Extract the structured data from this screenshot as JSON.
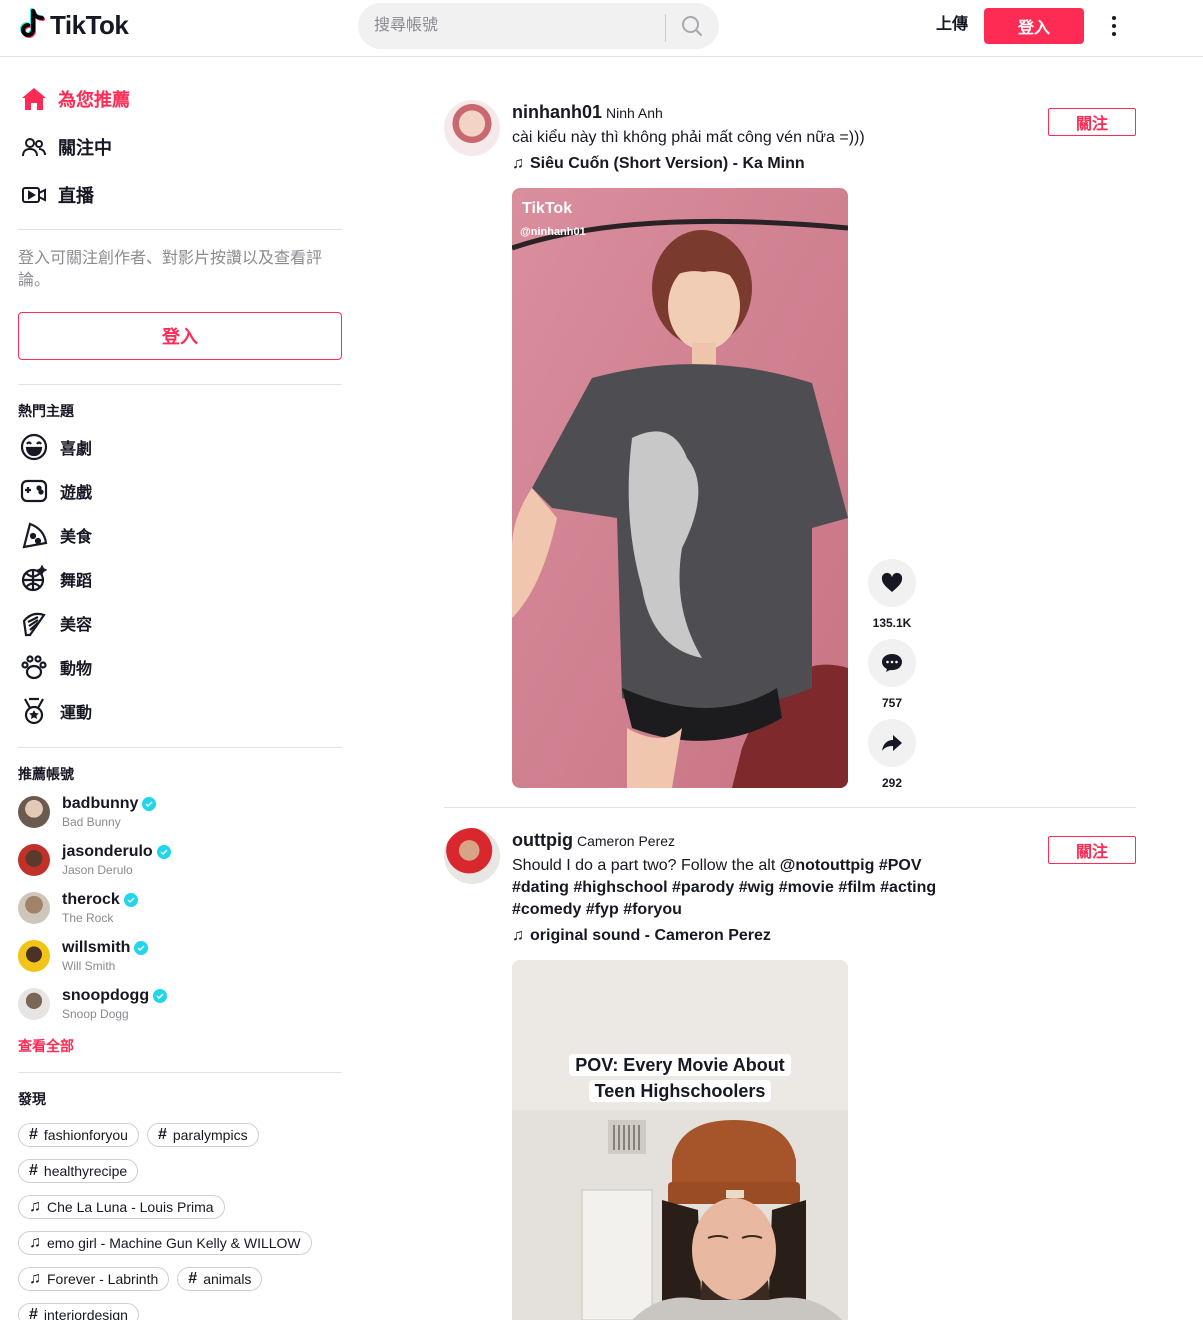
{
  "header": {
    "logo_text": "TikTok",
    "search_placeholder": "搜尋帳號",
    "upload_label": "上傳",
    "login_label": "登入"
  },
  "sidebar": {
    "nav": [
      {
        "label": "為您推薦",
        "icon": "home-icon",
        "active": true
      },
      {
        "label": "關注中",
        "icon": "users-icon"
      },
      {
        "label": "直播",
        "icon": "live-icon"
      }
    ],
    "login_note": "登入可關注創作者、對影片按讚以及查看評論。",
    "login_button": "登入",
    "topics_title": "熱門主題",
    "topics": [
      {
        "label": "喜劇",
        "icon": "comedy-icon"
      },
      {
        "label": "遊戲",
        "icon": "gaming-icon"
      },
      {
        "label": "美食",
        "icon": "food-icon"
      },
      {
        "label": "舞蹈",
        "icon": "dance-icon"
      },
      {
        "label": "美容",
        "icon": "beauty-icon"
      },
      {
        "label": "動物",
        "icon": "animals-icon"
      },
      {
        "label": "運動",
        "icon": "sports-icon"
      }
    ],
    "accounts_title": "推薦帳號",
    "accounts": [
      {
        "handle": "badbunny",
        "name": "Bad Bunny",
        "color": "#6b5a4e"
      },
      {
        "handle": "jasonderulo",
        "name": "Jason Derulo",
        "color": "#c2302a"
      },
      {
        "handle": "therock",
        "name": "The Rock",
        "color": "#8a7a68"
      },
      {
        "handle": "willsmith",
        "name": "Will Smith",
        "color": "#f2c318"
      },
      {
        "handle": "snoopdogg",
        "name": "Snoop Dogg",
        "color": "#b9b4ae"
      }
    ],
    "see_all": "查看全部",
    "discover_title": "發現",
    "discover": [
      {
        "type": "hashtag",
        "label": "fashionforyou"
      },
      {
        "type": "hashtag",
        "label": "paralympics"
      },
      {
        "type": "hashtag",
        "label": "healthyrecipe"
      },
      {
        "type": "music",
        "label": "Che La Luna - Louis Prima"
      },
      {
        "type": "music",
        "label": "emo girl - Machine Gun Kelly & WILLOW"
      },
      {
        "type": "music",
        "label": "Forever - Labrinth"
      },
      {
        "type": "hashtag",
        "label": "animals"
      },
      {
        "type": "hashtag",
        "label": "interiordesign"
      }
    ]
  },
  "posts": [
    {
      "handle": "ninhanh01",
      "nickname": "Ninh Anh",
      "caption_text": "cài kiểu này thì không phải mất công vén nữa =)))",
      "music": "Siêu Cuốn (Short Version) - Ka Minn",
      "follow_label": "關注",
      "watermark_logo": "TikTok",
      "watermark_handle": "@ninhanh01",
      "likes": "135.1K",
      "comments": "757",
      "shares": "292"
    },
    {
      "handle": "outtpig",
      "nickname": "Cameron Perez",
      "caption_prefix": "Should I do a part two? Follow the alt ",
      "caption_tags": [
        "@notouttpig",
        "#POV",
        "#dating",
        "#highschool",
        "#parody",
        "#wig",
        "#movie",
        "#film",
        "#acting",
        "#comedy",
        "#fyp",
        "#foryou"
      ],
      "music": "original sound - Cameron Perez",
      "follow_label": "關注",
      "overlay_line1": "POV: Every Movie About",
      "overlay_line2": "Teen Highschoolers"
    }
  ],
  "colors": {
    "brand": "#fe2c55",
    "text": "#161823",
    "muted": "#8a8b91",
    "verified": "#20d5ec",
    "divider": "#e3e3e4"
  }
}
